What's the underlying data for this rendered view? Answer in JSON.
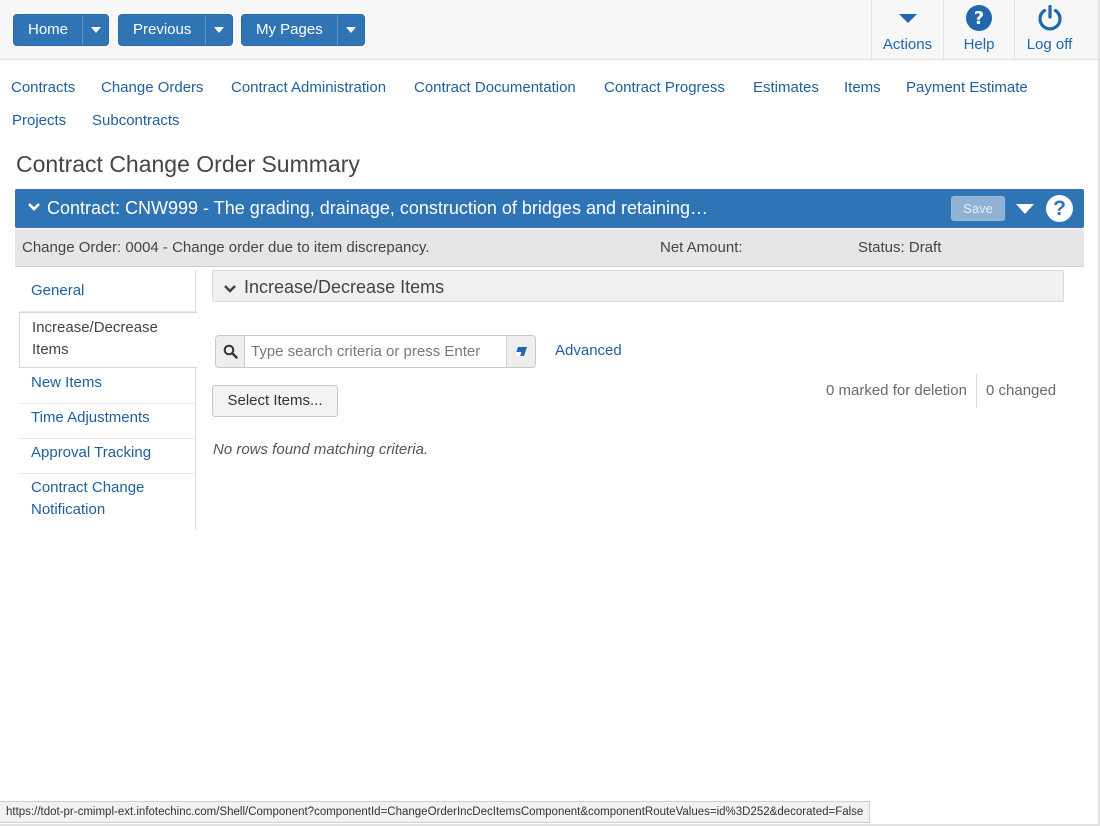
{
  "topnav": {
    "buttons": [
      {
        "label": "Home"
      },
      {
        "label": "Previous"
      },
      {
        "label": "My Pages"
      }
    ],
    "right": [
      {
        "label": "Actions",
        "icon": "chevron-down-icon"
      },
      {
        "label": "Help",
        "icon": "help-icon"
      },
      {
        "label": "Log off",
        "icon": "power-icon"
      }
    ]
  },
  "menu": {
    "items": [
      "Contracts",
      "Change Orders",
      "Contract Administration",
      "Contract Documentation",
      "Contract Progress",
      "Estimates",
      "Items",
      "Payment Estimate",
      "Projects",
      "Subcontracts"
    ]
  },
  "page": {
    "title": "Contract Change Order Summary"
  },
  "contract_bar": {
    "title": "Contract: CNW999 - The grading, drainage, construction of bridges and retaining…",
    "save_label": "Save"
  },
  "change_order": {
    "description": "Change Order: 0004 - Change order due to item discrepancy.",
    "net_amount_label": "Net Amount:",
    "status": "Status: Draft"
  },
  "leftnav": {
    "items": [
      {
        "label": "General"
      },
      {
        "label": "Increase/Decrease Items"
      },
      {
        "label": "New Items"
      },
      {
        "label": "Time Adjustments"
      },
      {
        "label": "Approval Tracking"
      },
      {
        "label": "Contract Change Notification"
      }
    ]
  },
  "section": {
    "title": "Increase/Decrease Items"
  },
  "search": {
    "placeholder": "Type search criteria or press Enter",
    "value": "",
    "advanced_label": "Advanced"
  },
  "toolbar": {
    "select_items_label": "Select Items...",
    "marked_for_deletion": "0 marked for deletion",
    "changed": "0 changed"
  },
  "results": {
    "empty_message": "No rows found matching criteria."
  },
  "status_bar": {
    "url": "https://tdot-pr-cmimpl-ext.infotechinc.com/Shell/Component?componentId=ChangeOrderIncDecItemsComponent&componentRouteValues=id%3D252&decorated=False"
  },
  "colors": {
    "primary": "#2f74b5",
    "link": "#1f5f9e"
  }
}
